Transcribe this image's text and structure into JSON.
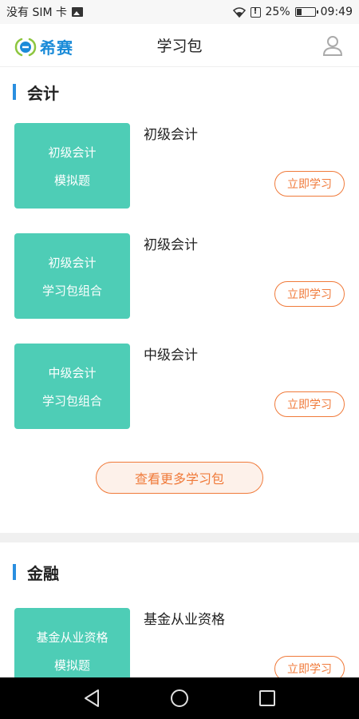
{
  "status_bar": {
    "carrier": "没有 SIM 卡",
    "battery_percent": "25%",
    "battery_level": 0.25,
    "time": "09:49"
  },
  "header": {
    "logo_text": "希赛",
    "title": "学习包"
  },
  "sections": [
    {
      "title": "会计",
      "courses": [
        {
          "thumb_line1": "初级会计",
          "thumb_line2": "模拟题",
          "name": "初级会计",
          "button": "立即学习"
        },
        {
          "thumb_line1": "初级会计",
          "thumb_line2": "学习包组合",
          "name": "初级会计",
          "button": "立即学习"
        },
        {
          "thumb_line1": "中级会计",
          "thumb_line2": "学习包组合",
          "name": "中级会计",
          "button": "立即学习"
        }
      ],
      "more_button": "查看更多学习包"
    },
    {
      "title": "金融",
      "courses": [
        {
          "thumb_line1": "基金从业资格",
          "thumb_line2": "模拟题",
          "name": "基金从业资格",
          "button": "立即学习"
        }
      ]
    }
  ],
  "colors": {
    "accent_blue": "#2a8fe0",
    "thumb_teal": "#4ecdb6",
    "action_orange": "#f07a3a"
  },
  "icons": [
    "image-icon",
    "wifi-icon",
    "alert-icon",
    "battery-icon",
    "user-icon",
    "back-icon",
    "home-icon",
    "recents-icon"
  ]
}
